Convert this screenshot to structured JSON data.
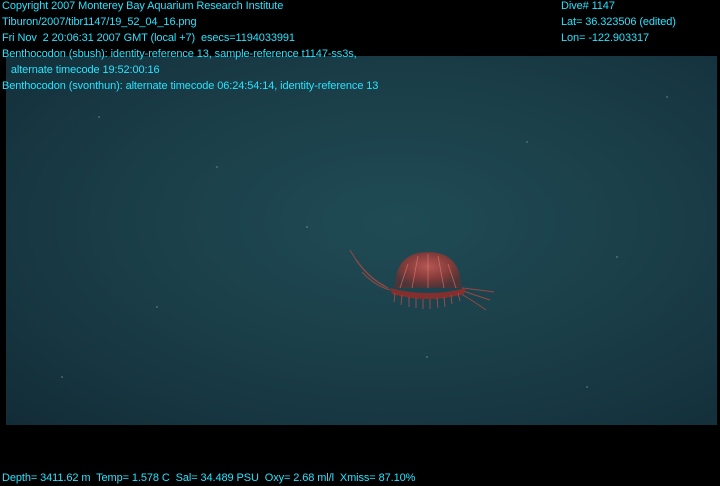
{
  "header": {
    "copyright": "Copyright 2007 Monterey Bay Aquarium Research Institute",
    "filepath": "Tiburon/2007/tibr1147/19_52_04_16.png",
    "datetime": "Fri Nov  2 20:06:31 2007 GMT (local +7)  esecs=1194033991",
    "annotation_1": "Benthocodon (sbush): identity-reference 13, sample-reference t1147-ss3s,",
    "annotation_1_cont": "   alternate timecode 19:52:00:16",
    "annotation_2": "Benthocodon (svonthun): alternate timecode 06:24:54:14, identity-reference 13"
  },
  "dive_info": {
    "dive": "Dive# 1147",
    "lat": "Lat= 36.323506 (edited)",
    "lon": "Lon= -122.903317"
  },
  "footer": {
    "telemetry": "Depth= 3411.62 m  Temp= 1.578 C  Sal= 34.489 PSU  Oxy= 2.68 ml/l  Xmiss= 87.10%"
  },
  "colors": {
    "overlay_text": "#27e3ff",
    "water": "#1b3f49",
    "jellyfish": "#c0392b"
  }
}
